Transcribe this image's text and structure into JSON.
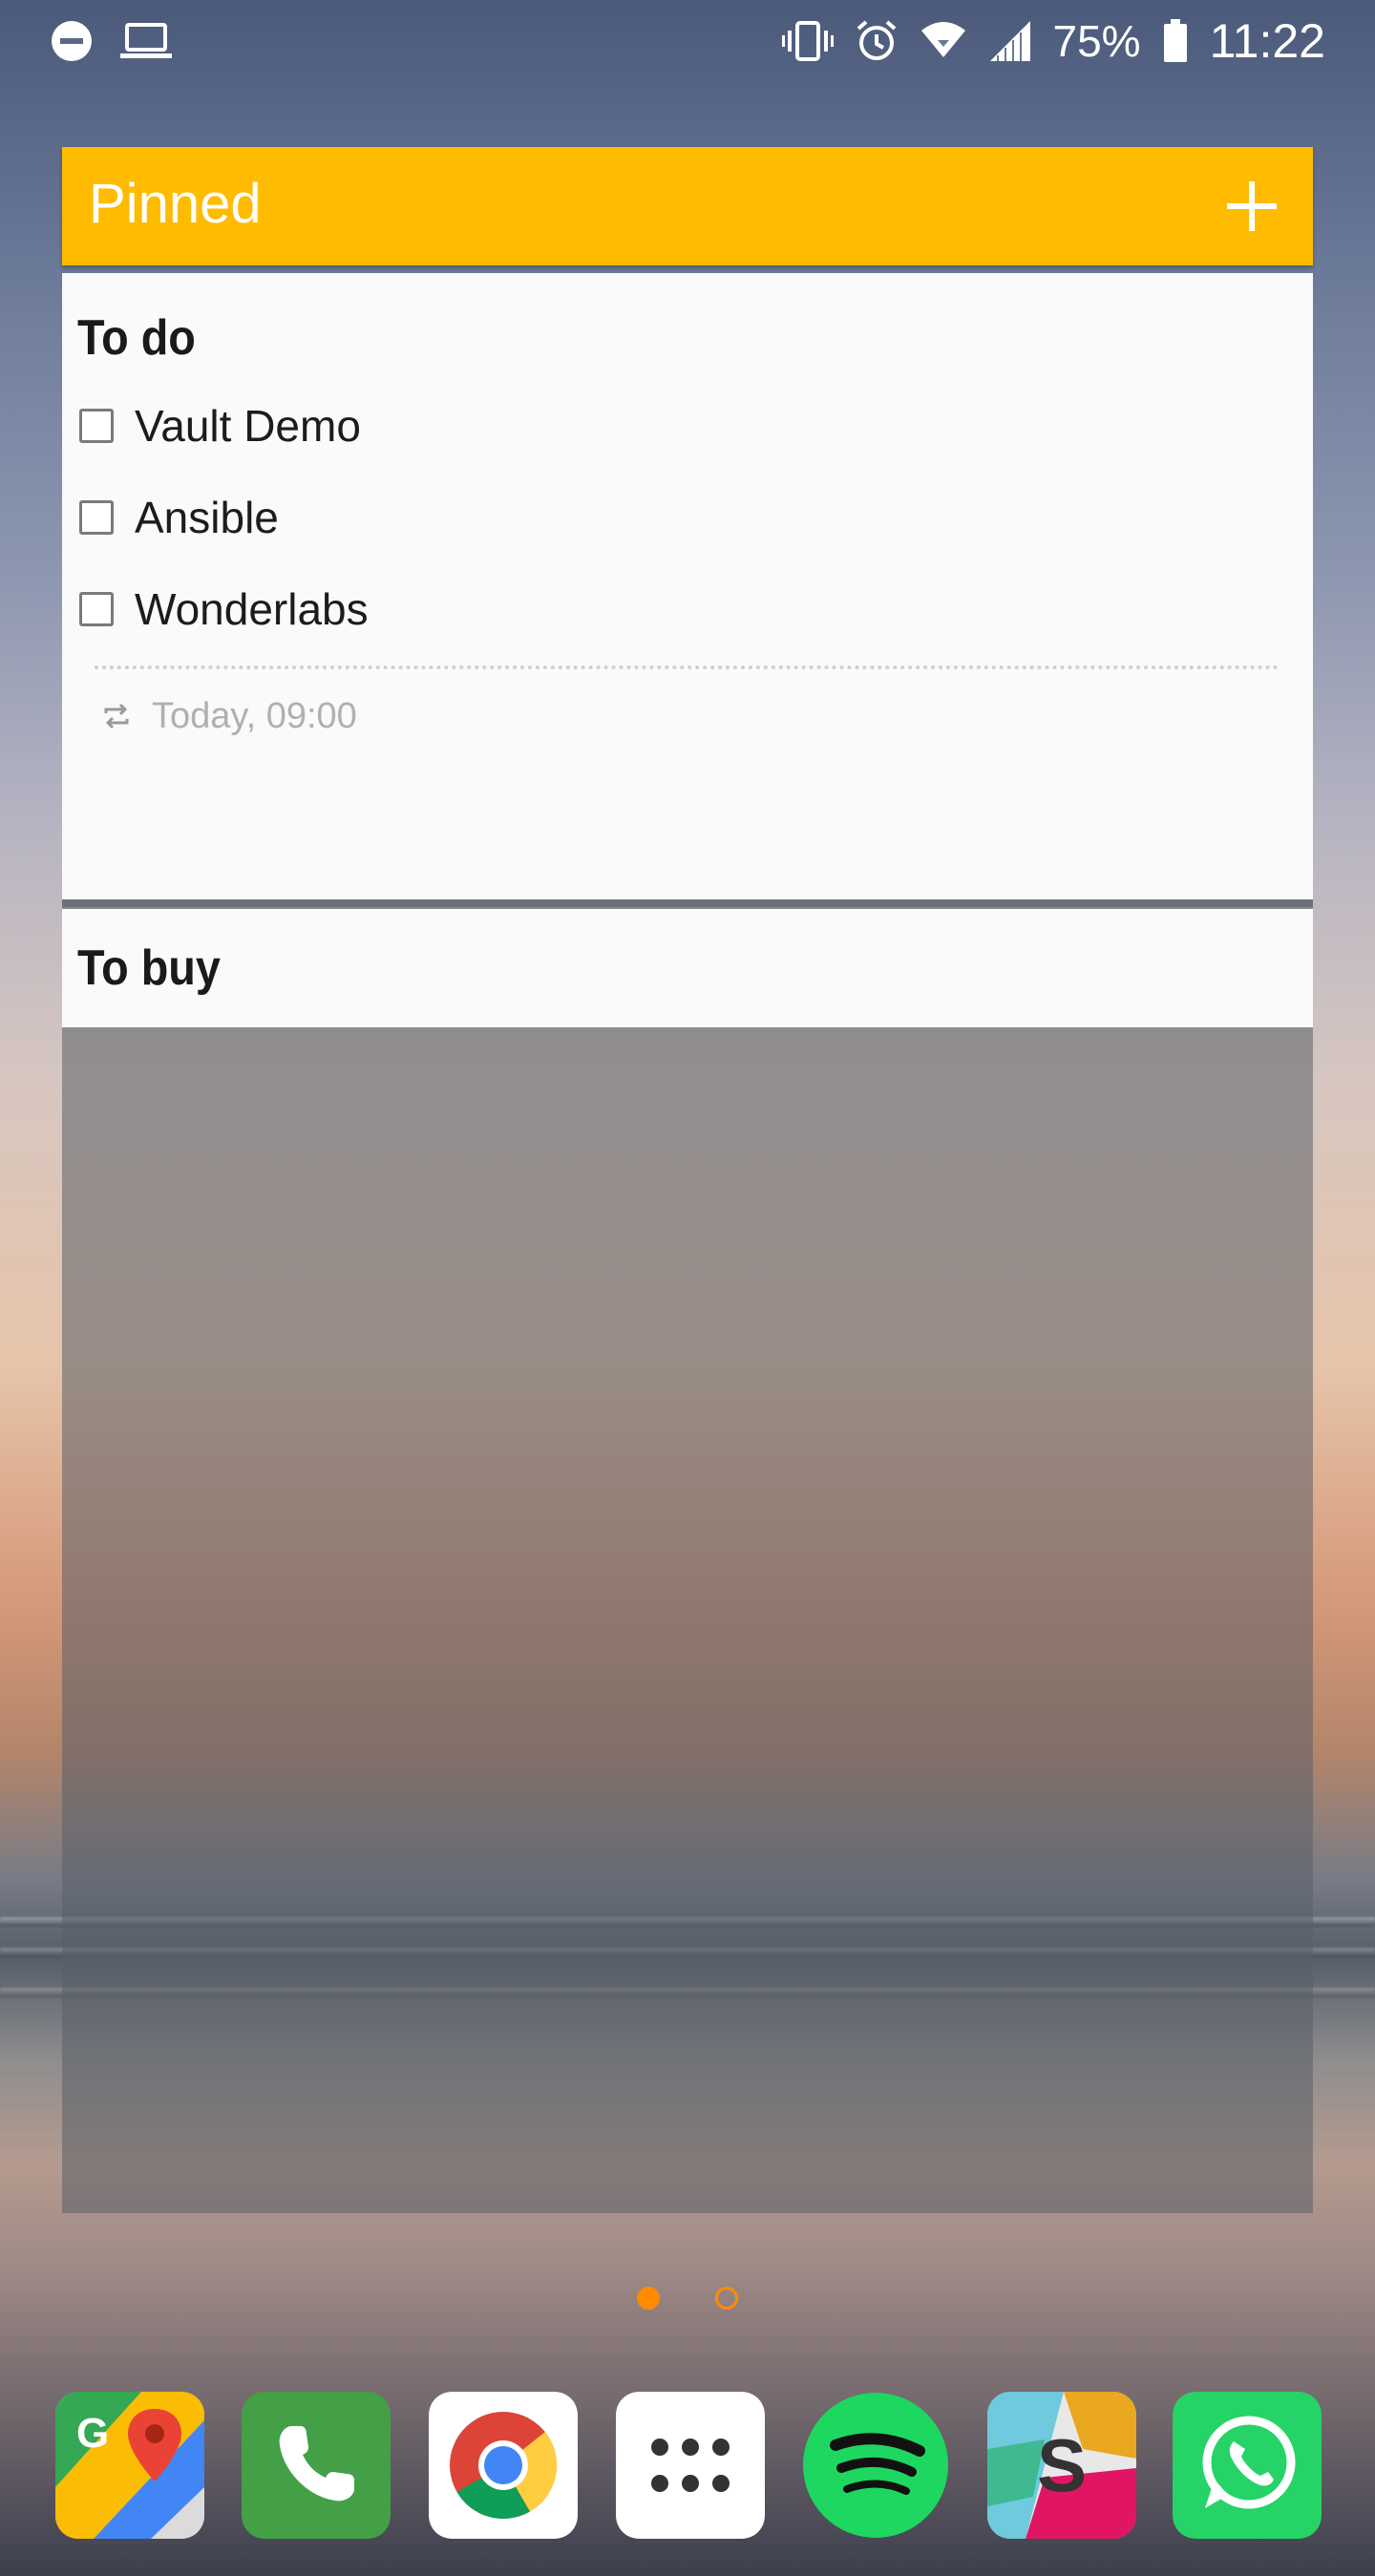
{
  "status_bar": {
    "battery_percent": "75%",
    "time": "11:22",
    "left_icons": [
      "dnd-icon",
      "laptop-icon"
    ],
    "right_icons": [
      "vibrate-icon",
      "alarm-icon",
      "wifi-icon",
      "signal-icon",
      "battery-icon"
    ]
  },
  "widget": {
    "title": "Pinned",
    "accent_color": "#FFBB00",
    "add_icon": "plus-icon",
    "notes": [
      {
        "title": "To do",
        "items": [
          {
            "label": "Vault Demo",
            "checked": false
          },
          {
            "label": "Ansible",
            "checked": false
          },
          {
            "label": "Wonderlabs",
            "checked": false
          }
        ],
        "reminder": {
          "icon": "repeat-icon",
          "text": "Today, 09:00"
        }
      },
      {
        "title": "To buy",
        "items": []
      }
    ]
  },
  "page_indicator": {
    "pages": 2,
    "current": 1,
    "color": "#FF8C00"
  },
  "dock": {
    "apps": [
      {
        "name": "Maps",
        "icon": "google-maps-icon"
      },
      {
        "name": "Phone",
        "icon": "phone-icon"
      },
      {
        "name": "Chrome",
        "icon": "chrome-icon"
      },
      {
        "name": "Apps",
        "icon": "app-drawer-icon"
      },
      {
        "name": "Spotify",
        "icon": "spotify-icon"
      },
      {
        "name": "Slack",
        "icon": "slack-icon"
      },
      {
        "name": "WhatsApp",
        "icon": "whatsapp-icon"
      }
    ]
  }
}
